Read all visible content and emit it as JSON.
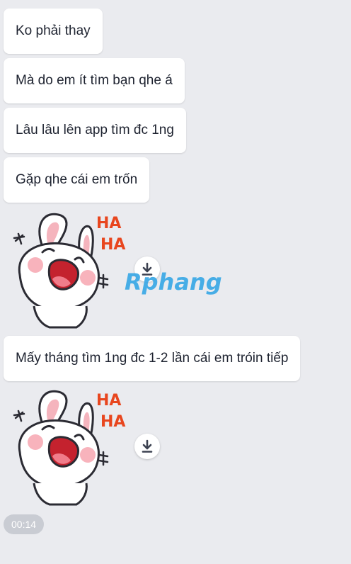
{
  "messages": [
    {
      "text": "Ko phải thay"
    },
    {
      "text": "Mà do em ít tìm bạn qhe á"
    },
    {
      "text": "Lâu lâu lên app tìm đc 1ng"
    },
    {
      "text": "Gặp qhe cái em trốn"
    },
    {
      "text": "Mấy tháng tìm 1ng đc 1-2 lần cái em tróin tiếp"
    }
  ],
  "stickers": [
    {
      "text_1": "HA",
      "text_2": "HA",
      "icon": "laughing-rabbit-sticker"
    },
    {
      "text_1": "HA",
      "text_2": "HA",
      "icon": "laughing-rabbit-sticker"
    }
  ],
  "watermark": {
    "text": "Rphang"
  },
  "timestamp": {
    "text": "00:14"
  },
  "colors": {
    "background": "#eaebef",
    "bubble": "#ffffff",
    "text": "#1e2330",
    "sticker_text": "#e8461e",
    "watermark_blue": "#3aa8e6",
    "watermark_red": "#e0403a",
    "badge": "#c9ccd3"
  }
}
